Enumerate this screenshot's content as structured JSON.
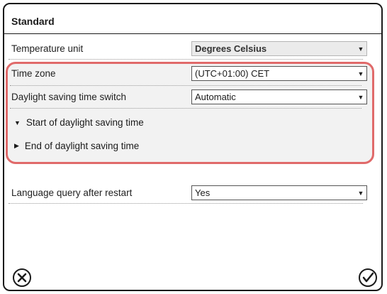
{
  "title": "Standard",
  "temperature_unit": {
    "label": "Temperature unit",
    "value": "Degrees Celsius"
  },
  "time_zone": {
    "label": "Time zone",
    "value": "(UTC+01:00) CET"
  },
  "dst_switch": {
    "label": "Daylight saving time switch",
    "value": "Automatic"
  },
  "dst_start": {
    "label": "Start of daylight saving time"
  },
  "dst_end": {
    "label": "End of daylight saving time"
  },
  "language_query": {
    "label": "Language query after restart",
    "value": "Yes"
  },
  "icons": {
    "cancel": "cancel-x-icon",
    "confirm": "confirm-check-icon"
  },
  "colors": {
    "highlight": "#e06a6a",
    "group_bg": "#f2f2f2",
    "disabled_bg": "#ebebeb"
  }
}
